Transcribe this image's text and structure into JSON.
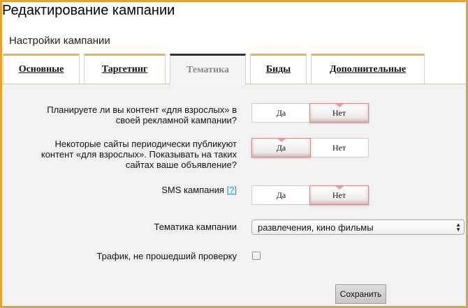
{
  "page_title": "Редактирование кампании",
  "section_title": "Настройки кампании",
  "tabs": [
    {
      "label": "Основные"
    },
    {
      "label": "Таргетинг"
    },
    {
      "label": "Тематика"
    },
    {
      "label": "Биды"
    },
    {
      "label": "Дополнительные"
    }
  ],
  "active_tab": "Тематика",
  "questions": {
    "adult_content": {
      "line1": "Планируете ли вы контент «для взрослых» в",
      "line2": "своей рекламной кампании?",
      "yes": "Да",
      "no": "Нет",
      "selected": "Нет"
    },
    "adult_sites": {
      "line1": "Некоторые сайты периодически публикуют",
      "line2": "контент «для взрослых». Показывать на таких",
      "line3": "сайтах ваше объявление?",
      "yes": "Да",
      "no": "Нет",
      "selected": "Да"
    },
    "sms": {
      "label": "SMS кампания",
      "help": "[?]",
      "yes": "Да",
      "no": "Нет",
      "selected": "Нет"
    }
  },
  "topic": {
    "label": "Тематика кампании",
    "value": "развлечения, кино фильмы"
  },
  "traffic": {
    "label": "Трафик, не прошедший проверку",
    "checked": false
  },
  "save_label": "Сохранить",
  "colors": {
    "frame": "#e0a33a",
    "tab_top": "#e7b45a",
    "selected_option_border": "#d98a8a",
    "help_link": "#1a8fd8"
  }
}
